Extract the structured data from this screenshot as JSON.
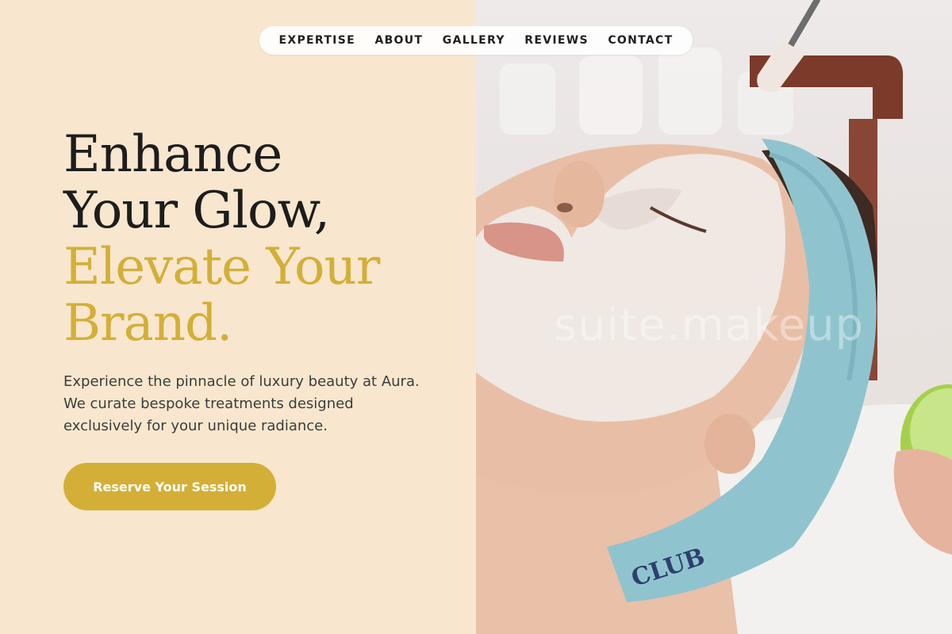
{
  "nav": {
    "items": [
      {
        "label": "EXPERTISE"
      },
      {
        "label": "ABOUT"
      },
      {
        "label": "GALLERY"
      },
      {
        "label": "REVIEWS"
      },
      {
        "label": "CONTACT"
      }
    ]
  },
  "hero": {
    "headline_line1": "Enhance",
    "headline_line2": "Your Glow,",
    "headline_line3": "Elevate Your",
    "headline_line4": "Brand.",
    "description": "Experience the pinnacle of luxury beauty at Aura. We curate bespoke treatments designed exclusively for your unique radiance.",
    "cta_label": "Reserve Your Session",
    "watermark": "suite.makeup",
    "headband_text": "CLUB"
  },
  "colors": {
    "background": "#f8e7ce",
    "accent_gold": "#d4af37",
    "heading_dark": "#1d1d1d",
    "body_text": "#3c3c3c"
  }
}
